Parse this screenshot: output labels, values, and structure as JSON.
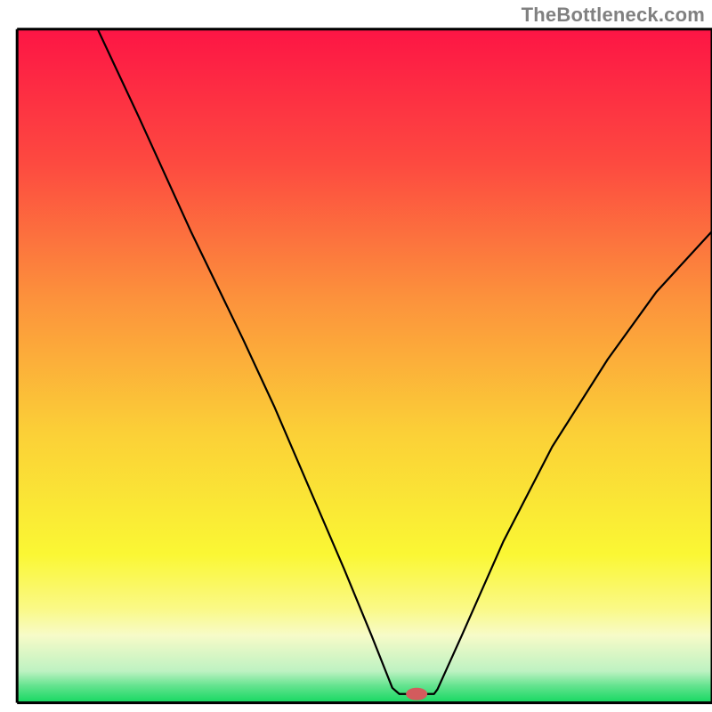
{
  "watermark": "TheBottleneck.com",
  "chart_data": {
    "type": "line",
    "title": "",
    "xlabel": "",
    "ylabel": "",
    "xlim": [
      0,
      100
    ],
    "ylim": [
      0,
      100
    ],
    "min_position_x": 57,
    "min_value": 0,
    "curve_points": [
      {
        "x": 11.6,
        "y": 100
      },
      {
        "x": 17.5,
        "y": 87
      },
      {
        "x": 25.0,
        "y": 70
      },
      {
        "x": 32.5,
        "y": 54
      },
      {
        "x": 37.0,
        "y": 44
      },
      {
        "x": 42.0,
        "y": 32
      },
      {
        "x": 47.0,
        "y": 20
      },
      {
        "x": 51.0,
        "y": 10
      },
      {
        "x": 54.0,
        "y": 2.2
      },
      {
        "x": 55.0,
        "y": 1.3
      },
      {
        "x": 60.0,
        "y": 1.3
      },
      {
        "x": 60.5,
        "y": 2.0
      },
      {
        "x": 64.0,
        "y": 10
      },
      {
        "x": 70.0,
        "y": 24
      },
      {
        "x": 77.0,
        "y": 38
      },
      {
        "x": 85.0,
        "y": 51
      },
      {
        "x": 92.0,
        "y": 61
      },
      {
        "x": 100.0,
        "y": 70
      }
    ],
    "gradient_stops": [
      {
        "offset": 0.0,
        "color": "#fd1545"
      },
      {
        "offset": 0.2,
        "color": "#fd4a40"
      },
      {
        "offset": 0.4,
        "color": "#fc923c"
      },
      {
        "offset": 0.6,
        "color": "#fbd037"
      },
      {
        "offset": 0.78,
        "color": "#faf734"
      },
      {
        "offset": 0.86,
        "color": "#faf986"
      },
      {
        "offset": 0.9,
        "color": "#f7fbc8"
      },
      {
        "offset": 0.953,
        "color": "#bef2c2"
      },
      {
        "offset": 0.975,
        "color": "#63e38e"
      },
      {
        "offset": 1.0,
        "color": "#15d861"
      }
    ],
    "marker": {
      "x": 57.5,
      "y": 1.3,
      "color": "#d35b5d",
      "rx": 12,
      "ry": 7
    },
    "frame_color": "#000000",
    "frame_left": 2.4,
    "frame_right": 100,
    "frame_top": 4.1,
    "frame_bottom_y": 98.7
  }
}
